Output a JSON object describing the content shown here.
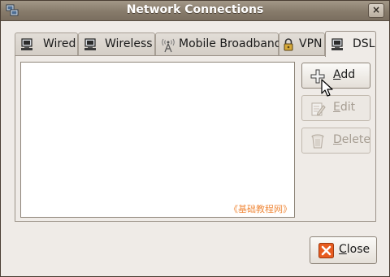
{
  "window": {
    "title": "Network Connections",
    "close_glyph": "×"
  },
  "tabs": [
    {
      "label": "Wired",
      "icon": "computer-network-icon",
      "active": false
    },
    {
      "label": "Wireless",
      "icon": "computer-network-icon",
      "active": false
    },
    {
      "label": "Mobile Broadband",
      "icon": "antenna-tower-icon",
      "active": false
    },
    {
      "label": "VPN",
      "icon": "padlock-icon",
      "active": false
    },
    {
      "label": "DSL",
      "icon": "computer-network-icon",
      "active": true
    }
  ],
  "connections": {
    "items": [],
    "watermark": "《基础教程网》"
  },
  "actions": {
    "add": {
      "prefix": "",
      "mnemonic": "A",
      "rest": "dd",
      "enabled": true
    },
    "edit": {
      "prefix": "",
      "mnemonic": "E",
      "rest": "dit",
      "enabled": false
    },
    "delete": {
      "prefix": "",
      "mnemonic": "D",
      "rest": "elete",
      "enabled": false
    }
  },
  "footer": {
    "close": {
      "mnemonic": "C",
      "rest": "lose"
    }
  },
  "colors": {
    "titlebar": "#877b6b",
    "window_bg": "#efebe7",
    "close_icon": "#e85c1f",
    "watermark": "#f08a3c"
  }
}
